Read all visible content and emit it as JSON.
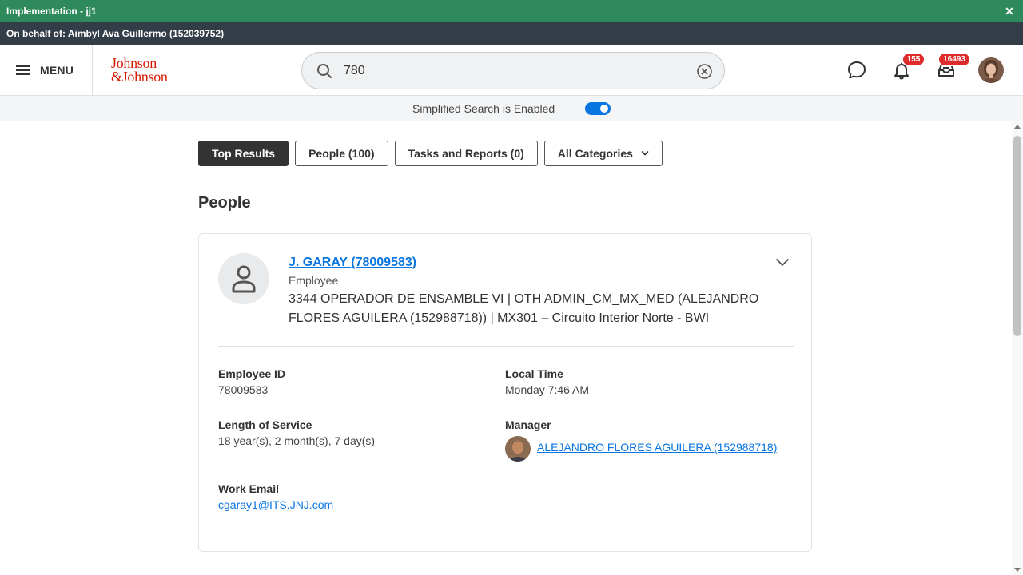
{
  "env_bar": {
    "title": "Implementation - jj1",
    "close_icon": "close-icon"
  },
  "behalf_bar": {
    "text": "On behalf of: Aimbyl Ava Guillermo (152039752)"
  },
  "header": {
    "menu_label": "MENU",
    "logo_line1": "Johnson",
    "logo_line2": "&Johnson",
    "brand_color": "#d51900",
    "search": {
      "value": "780",
      "placeholder": "Search"
    },
    "notifications_count": "155",
    "inbox_count": "16493"
  },
  "simplified": {
    "text": "Simplified Search is Enabled",
    "enabled": true
  },
  "filters": [
    {
      "label": "Top Results",
      "active": true
    },
    {
      "label": "People (100)",
      "active": false
    },
    {
      "label": "Tasks and Reports (0)",
      "active": false
    },
    {
      "label": "All Categories",
      "active": false
    }
  ],
  "section_title": "People",
  "person": {
    "name": "J. GARAY (78009583)",
    "type": "Employee",
    "description": "3344 OPERADOR DE ENSAMBLE VI | OTH ADMIN_CM_MX_MED (ALEJANDRO FLORES AGUILERA (152988718)) | MX301 – Circuito Interior Norte - BWI",
    "employee_id_label": "Employee ID",
    "employee_id": "78009583",
    "local_time_label": "Local Time",
    "local_time": "Monday 7:46 AM",
    "length_of_service_label": "Length of Service",
    "length_of_service": "18 year(s), 2 month(s), 7 day(s)",
    "manager_label": "Manager",
    "manager": "ALEJANDRO FLORES AGUILERA (152988718)",
    "work_email_label": "Work Email",
    "work_email": "cgaray1@ITS.JNJ.com"
  },
  "colors": {
    "env_green": "#2f8a5b",
    "behalf_dark": "#333d47",
    "link_blue": "#0875e1",
    "badge_red": "#de2b2b"
  }
}
